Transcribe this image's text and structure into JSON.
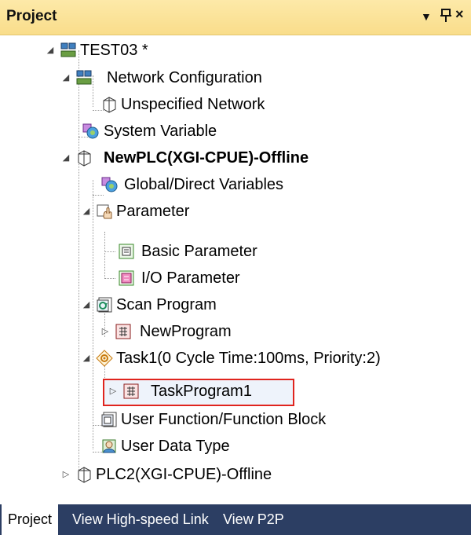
{
  "panel": {
    "title": "Project",
    "dropdown_glyph": "▼",
    "pin_glyph": "ᵖ",
    "close_glyph": "×"
  },
  "tree": {
    "nodes": [
      {
        "label": "TEST03 *",
        "icon": "project-icon",
        "expanded": true
      },
      {
        "label": "Network Configuration",
        "icon": "network-icon",
        "expanded": true
      },
      {
        "label": "Unspecified Network",
        "icon": "plc-cube-icon"
      },
      {
        "label": "System Variable",
        "icon": "variable-icon"
      },
      {
        "label": "NewPLC(XGI-CPUE)-Offline",
        "icon": "plc-cube-icon",
        "expanded": true,
        "bold": true
      },
      {
        "label": "Global/Direct Variables",
        "icon": "variable-icon"
      },
      {
        "label": "Parameter",
        "icon": "parameter-icon",
        "expanded": true
      },
      {
        "label": "Basic Parameter",
        "icon": "basic-parameter-icon"
      },
      {
        "label": "I/O Parameter",
        "icon": "io-parameter-icon"
      },
      {
        "label": "Scan Program",
        "icon": "scan-program-icon",
        "expanded": true
      },
      {
        "label": "NewProgram",
        "icon": "program-icon",
        "expanded": false
      },
      {
        "label": "Task1(0 Cycle Time:100ms, Priority:2)",
        "icon": "task-icon",
        "expanded": true
      },
      {
        "label": "TaskProgram1",
        "icon": "program-icon",
        "expanded": false,
        "selected": true
      },
      {
        "label": "User Function/Function Block",
        "icon": "function-block-icon"
      },
      {
        "label": "User Data Type",
        "icon": "data-type-icon"
      },
      {
        "label": "PLC2(XGI-CPUE)-Offline",
        "icon": "plc-cube-icon",
        "expanded": false
      }
    ]
  },
  "tabs": [
    {
      "label": "Project",
      "active": true
    },
    {
      "label": "View High-speed Link",
      "active": false
    },
    {
      "label": "View P2P",
      "active": false
    }
  ],
  "colors": {
    "title_bar": "#f9dd8b",
    "tab_strip": "#2c3e63",
    "selection_border": "#e0241e"
  }
}
